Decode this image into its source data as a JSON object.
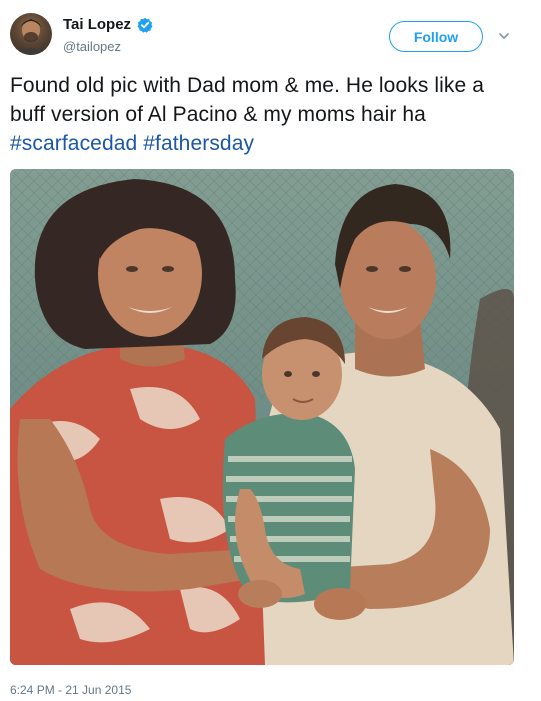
{
  "user": {
    "display_name": "Tai Lopez",
    "handle": "@tailopez",
    "verified": true,
    "avatar_icon": "user-avatar"
  },
  "actions": {
    "follow_label": "Follow",
    "more_icon": "chevron-down-icon"
  },
  "tweet": {
    "text_plain": "Found old pic with Dad mom & me. He looks like a buff version of Al Pacino & my moms hair ha",
    "hashtags": [
      "#scarfacedad",
      "#fathersday"
    ],
    "timestamp": "6:24 PM - 21 Jun 2015"
  },
  "colors": {
    "accent": "#1da1f2",
    "hashtag": "#1b57a6",
    "text": "#14171a",
    "muted": "#657786"
  }
}
